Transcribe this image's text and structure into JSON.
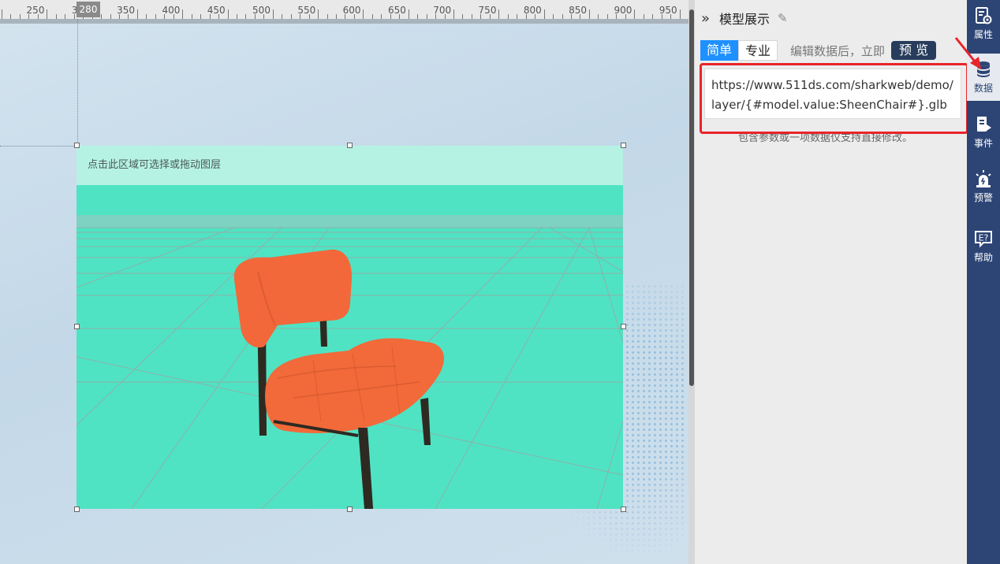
{
  "ruler": {
    "ticks": [
      "250",
      "300",
      "350",
      "400",
      "450",
      "500",
      "550",
      "600",
      "650",
      "700",
      "750",
      "800",
      "850",
      "900",
      "950"
    ],
    "position_marker": "280"
  },
  "canvas": {
    "layer_hint": "点击此区域可选择或拖动图层",
    "layer_background": "#4fe3c3",
    "chair_color": "#f2683a"
  },
  "panel": {
    "collapse_icon": "double-chevron-right-icon",
    "title": "模型展示",
    "edit_icon": "pencil-icon",
    "tabs": [
      {
        "label": "简单",
        "active": true
      },
      {
        "label": "专业",
        "active": false
      }
    ],
    "mode_desc": "编辑数据后，立即",
    "preview_label": "预 览",
    "url_value": "https://www.511ds.com/sharkweb/demo/layer/{#model.value:SheenChair#}.glb",
    "help_text": "包含参数或一项数据仅支持直接修改。",
    "highlight_color": "#e8252a"
  },
  "nav": {
    "items": [
      {
        "label": "属性",
        "icon": "properties-gear-icon",
        "active": false
      },
      {
        "label": "数据",
        "icon": "database-icon",
        "active": true
      },
      {
        "label": "事件",
        "icon": "event-icon",
        "active": false
      },
      {
        "label": "预警",
        "icon": "alarm-icon",
        "active": false
      },
      {
        "label": "帮助",
        "icon": "help-icon",
        "active": false
      }
    ]
  }
}
